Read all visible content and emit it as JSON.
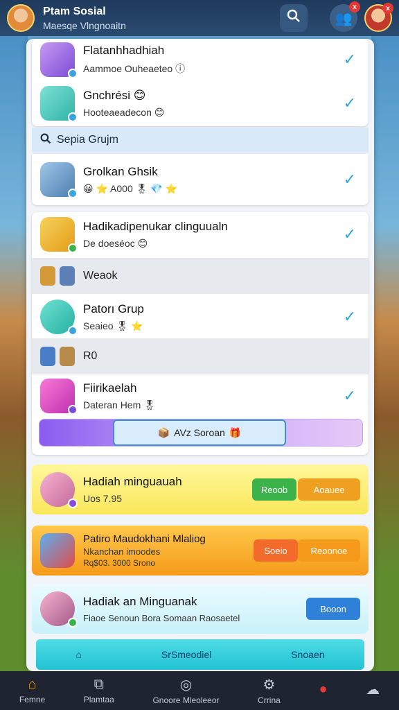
{
  "topbar": {
    "title": "Ptam Sosial",
    "subtitle": "Maesqe Vlngnoaitn",
    "search_icon": "search-icon",
    "friends_badge": "x",
    "profile_badge": "x"
  },
  "list": {
    "rows": [
      {
        "title": "Flatanhhadhiah",
        "sub": "Aammoe Ouheaeteo ⓘ"
      },
      {
        "title": "Gnchrési 😊",
        "sub": "Hooteaeadecon 😊"
      }
    ],
    "section_header": "Sepia Grujm",
    "group_row": {
      "title": "Grolkan Ghsik",
      "sub": "😀 ⭐ A000 🎖 💎 ⭐"
    },
    "card2_rows": [
      {
        "title": "Hadikadipenukar clinguualn",
        "sub": "De doeséoc 😊"
      }
    ],
    "strip1": "Weaok",
    "row_patan": {
      "title": "Patorı Grup",
      "sub": "Seaieo 🎖 ⭐"
    },
    "strip2": "R0",
    "row_fiik": {
      "title": "Fiirikaelah",
      "sub": "Dateran Hem 🎖"
    },
    "progress_label": "AVz Soroan"
  },
  "promos": [
    {
      "title": "Hadiah minguauah",
      "sub": "Uos 7.95",
      "btn1": "Reoob",
      "btn2": "Aoauee"
    },
    {
      "title": "Patiro Maudokhani Mlaliog",
      "sub": "Nkanchan imoodes",
      "sub2": "Rq$03. 3000 Srono",
      "btn1": "Soeio",
      "btn2": "Reoonoe"
    },
    {
      "title": "Hadiak an Minguanak",
      "sub": "Fiaoe Senoun Bora Somaan Raosaetel",
      "btn1": "Booon"
    }
  ],
  "footer": {
    "left": "SrSmeodiel",
    "right": "Snoaen"
  },
  "nav": [
    {
      "label": "Femne",
      "icon": "home-icon"
    },
    {
      "label": "Plamtaa",
      "icon": "puzzle-icon"
    },
    {
      "label": "Gnoore Mleoleeor",
      "icon": "compass-icon"
    },
    {
      "label": "Crrina",
      "icon": "gear-icon"
    },
    {
      "label": "",
      "icon": "alert-icon"
    },
    {
      "label": "",
      "icon": "ghost-icon"
    }
  ]
}
